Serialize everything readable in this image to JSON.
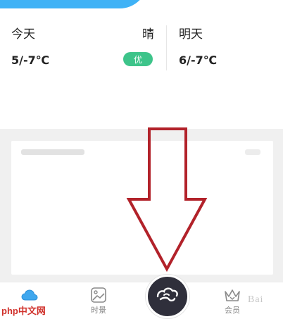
{
  "forecast": {
    "today": {
      "title": "今天",
      "weather": "晴",
      "temp": "5/-7℃",
      "aqi": "优"
    },
    "tomorrow": {
      "title": "明天",
      "temp": "6/-7℃"
    }
  },
  "tabbar": {
    "items": [
      {
        "label": "",
        "icon": "cloud-icon",
        "active": true
      },
      {
        "label": "时景",
        "icon": "image-icon"
      },
      {
        "label": "",
        "icon": "cloud-swirl-icon"
      },
      {
        "label": "会员",
        "icon": "crown-icon"
      }
    ]
  },
  "watermark": {
    "logo": "php中文网",
    "baidu": "Bai"
  },
  "colors": {
    "accent": "#3fb2f6",
    "aqi_good": "#3dc48a",
    "arrow": "#b2222a",
    "center_button": "#2f2f3b"
  }
}
